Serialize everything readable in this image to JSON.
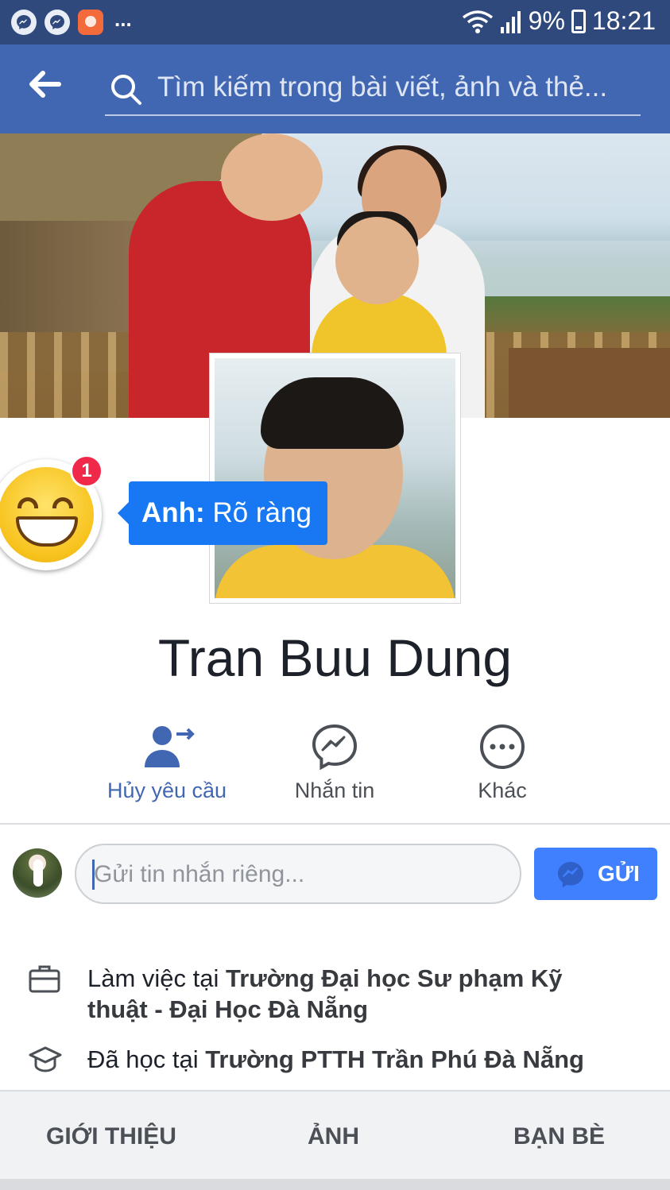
{
  "status_bar": {
    "more": "...",
    "battery": "9%",
    "time": "18:21"
  },
  "header": {
    "search_placeholder": "Tìm kiếm trong bài viết, ảnh và thẻ..."
  },
  "chat_head": {
    "badge_count": "1",
    "tooltip_name": "Anh:",
    "tooltip_message": "Rõ ràng"
  },
  "profile": {
    "name": "Tran Buu Dung"
  },
  "actions": [
    {
      "label": "Hủy yêu cầu",
      "icon": "friend-request-sent-icon"
    },
    {
      "label": "Nhắn tin",
      "icon": "messenger-icon"
    },
    {
      "label": "Khác",
      "icon": "more-icon"
    }
  ],
  "message": {
    "placeholder": "Gửi tin nhắn riêng...",
    "send_label": "GỬI"
  },
  "info": {
    "work_prefix": "Làm việc tại ",
    "work_place": "Trường Đại học Sư phạm Kỹ thuật - Đại Học Đà Nẵng",
    "study_prefix": "Đã học tại ",
    "study_place": "Trường PTTH Trần Phú Đà Nẵng"
  },
  "tabs": [
    "GIỚI THIỆU",
    "ẢNH",
    "BẠN BÈ"
  ],
  "colors": {
    "status_bar": "#30497d",
    "header": "#4267b2",
    "accent": "#4080ff",
    "badge": "#f02849"
  }
}
